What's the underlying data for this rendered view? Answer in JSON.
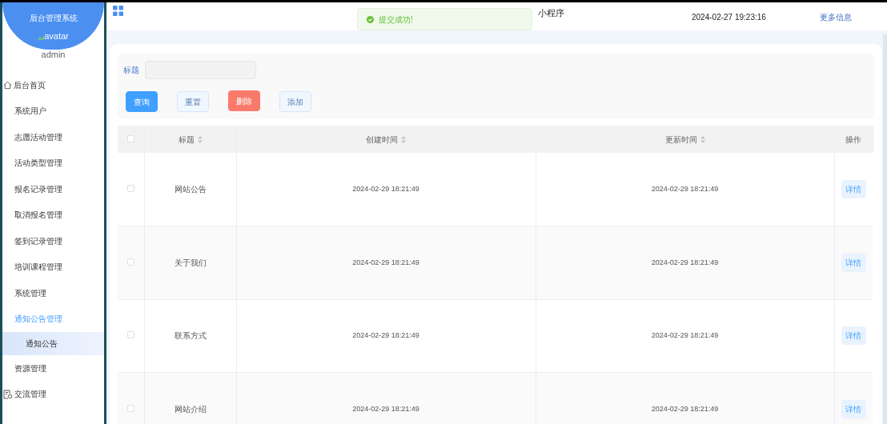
{
  "sidebar": {
    "title": "后台管理系统",
    "avatar_alt": "avatar",
    "username": "admin",
    "items": [
      {
        "label": "后台首页",
        "kind": "home",
        "selected": false
      },
      {
        "label": "系统用户",
        "selected": false
      },
      {
        "label": "志愿活动管理",
        "selected": false
      },
      {
        "label": "活动类型管理",
        "selected": false
      },
      {
        "label": "报名记录管理",
        "selected": false
      },
      {
        "label": "取消报名管理",
        "selected": false
      },
      {
        "label": "签到记录管理",
        "selected": false
      },
      {
        "label": "培训课程管理",
        "selected": false
      },
      {
        "label": "系统管理",
        "selected": false
      },
      {
        "label": "通知公告管理",
        "selected": false,
        "expanded": true,
        "children": [
          {
            "label": "通知公告",
            "selected": true
          }
        ]
      },
      {
        "label": "资源管理",
        "selected": false
      },
      {
        "label": "交流管理",
        "kind": "document",
        "selected": false
      }
    ]
  },
  "header": {
    "title": "小程序",
    "datetime": "2024-02-27 19:23:16",
    "more_link": "更多信息"
  },
  "toast": {
    "message": "提交成功!"
  },
  "search": {
    "label": "标题"
  },
  "buttons": [
    {
      "label": "查询",
      "kind": "primary"
    },
    {
      "label": "重置",
      "kind": "plain"
    },
    {
      "label": "删除",
      "kind": "danger"
    },
    {
      "label": "添加",
      "kind": "plain"
    }
  ],
  "table": {
    "header_checked": false,
    "columns": [
      {
        "label": "标题",
        "sortable": true
      },
      {
        "label": "创建时间",
        "sortable": true
      },
      {
        "label": "更新时间",
        "sortable": true
      },
      {
        "label": "操作",
        "sortable": false
      }
    ],
    "rows": [
      {
        "checked": false,
        "title": "网站公告",
        "created": "2024-02-29 18:21:49",
        "updated": "2024-02-29 18:21:49",
        "action": "详情"
      },
      {
        "checked": false,
        "title": "关于我们",
        "created": "2024-02-29 18:21:49",
        "updated": "2024-02-29 18:21:49",
        "action": "详情"
      },
      {
        "checked": false,
        "title": "联系方式",
        "created": "2024-02-29 18:21:49",
        "updated": "2024-02-29 18:21:49",
        "action": "详情"
      },
      {
        "checked": false,
        "title": "网站介绍",
        "created": "2024-02-29 18:21:49",
        "updated": "2024-02-29 18:21:49",
        "action": "详情"
      }
    ]
  }
}
